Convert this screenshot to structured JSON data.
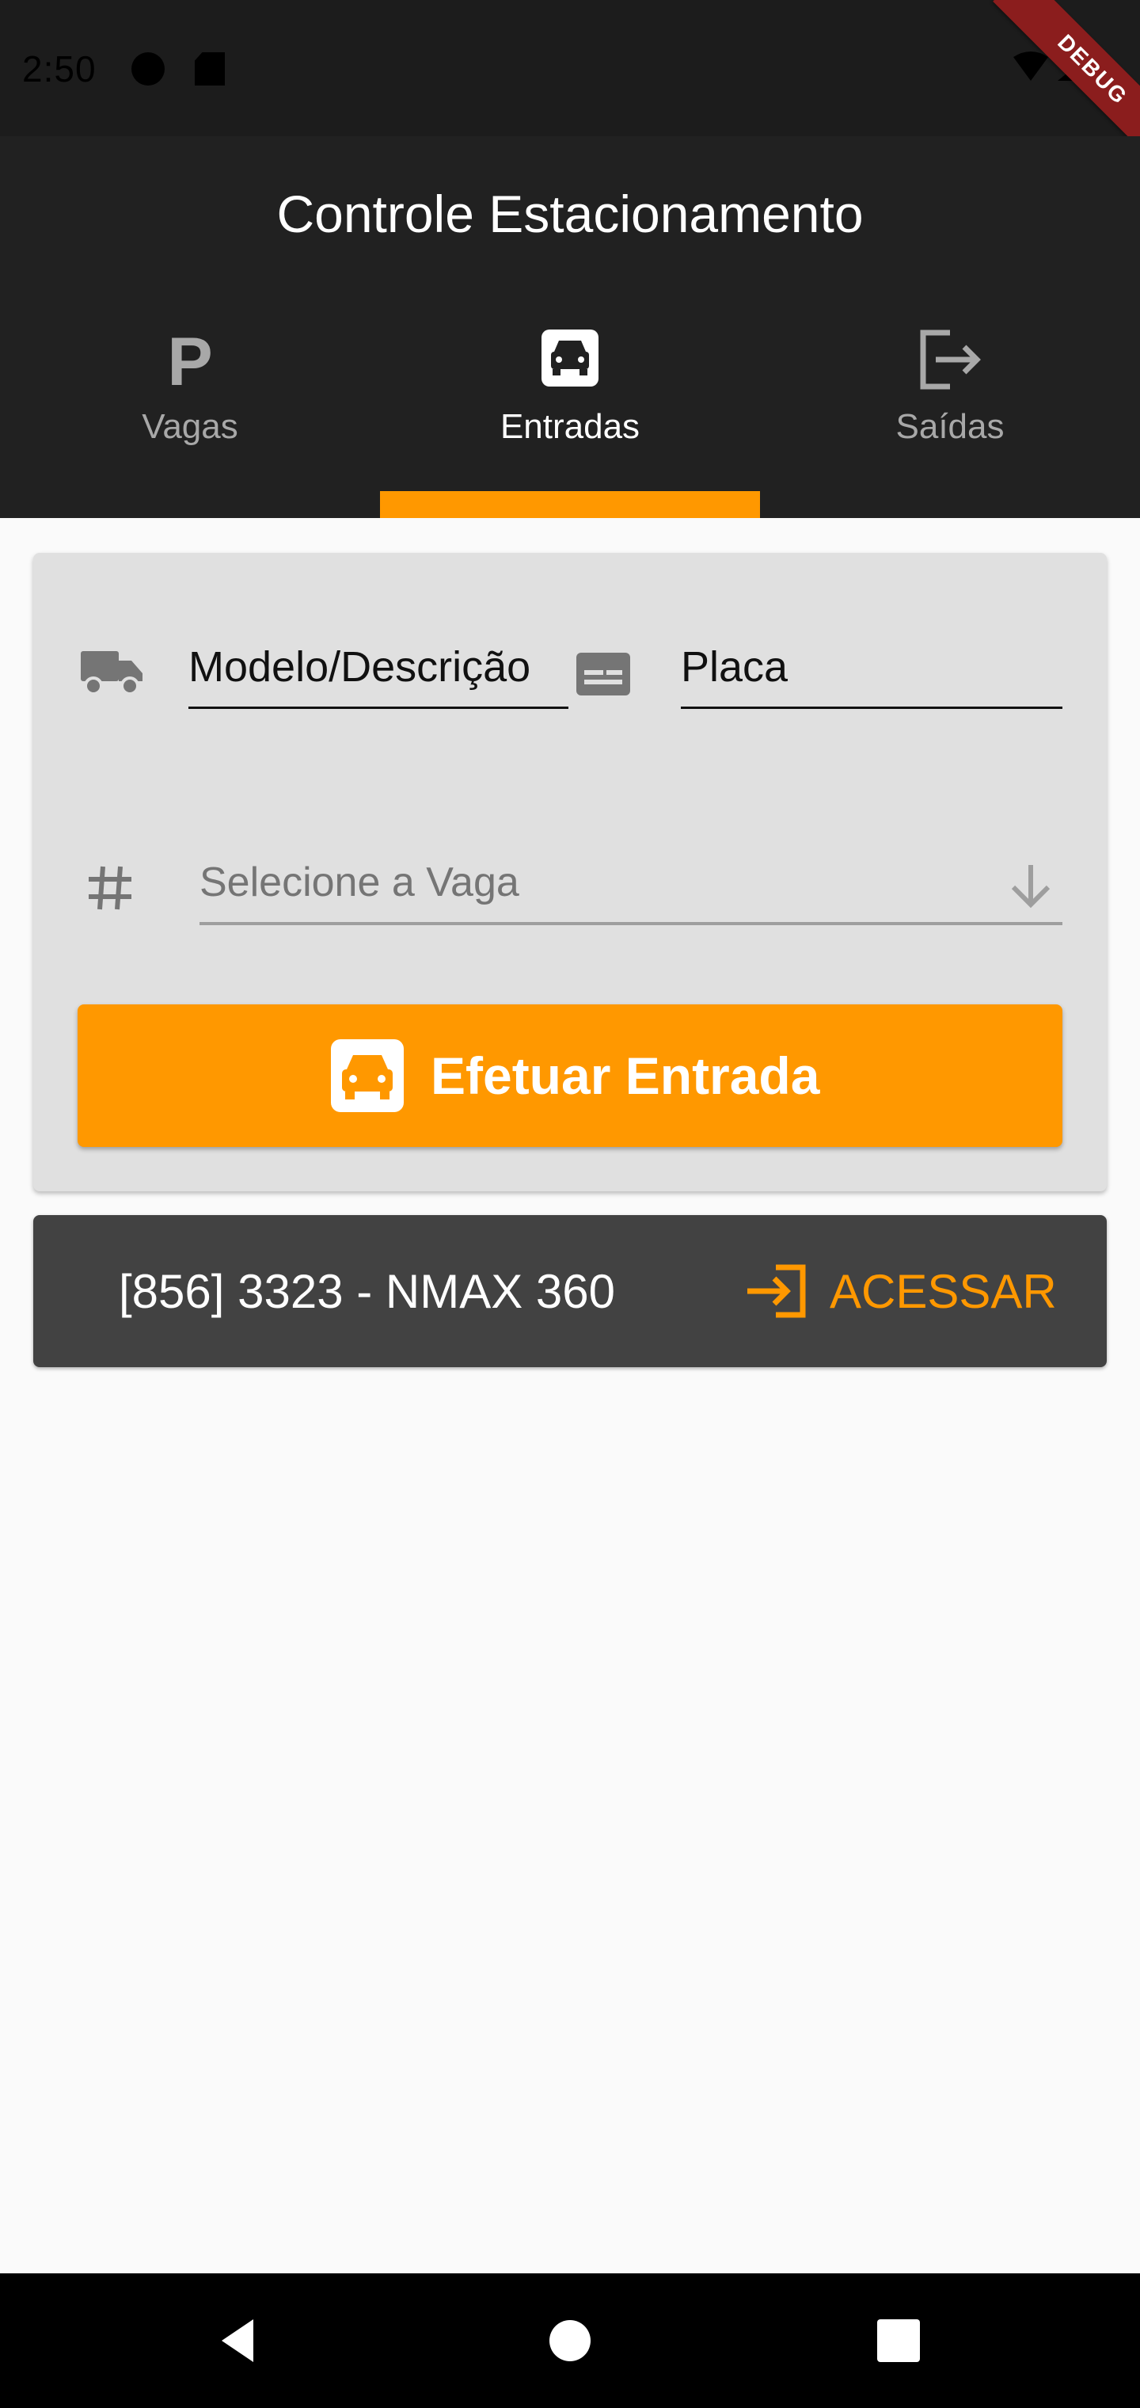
{
  "status_bar": {
    "time": "2:50",
    "debug_label": "DEBUG"
  },
  "app_bar": {
    "title": "Controle Estacionamento"
  },
  "tabs": [
    {
      "label": "Vagas",
      "icon": "parking-icon",
      "active": false
    },
    {
      "label": "Entradas",
      "icon": "car-icon",
      "active": true
    },
    {
      "label": "Saídas",
      "icon": "exit-icon",
      "active": false
    }
  ],
  "form": {
    "model_field": {
      "placeholder": "Modelo/Descrição",
      "value": "",
      "icon": "truck-icon"
    },
    "plate_field": {
      "placeholder": "Placa",
      "value": "",
      "icon": "plate-icon"
    },
    "spot_select": {
      "placeholder": "Selecione a Vaga",
      "icon": "hash-icon"
    },
    "submit_label": "Efetuar Entrada"
  },
  "entries": [
    {
      "text": "[856] 3323 - NMAX 360",
      "action_label": "ACESSAR"
    }
  ],
  "colors": {
    "accent": "#ff9800",
    "app_bar": "#212121",
    "card": "#e0e0e0",
    "list_item": "#424242"
  }
}
